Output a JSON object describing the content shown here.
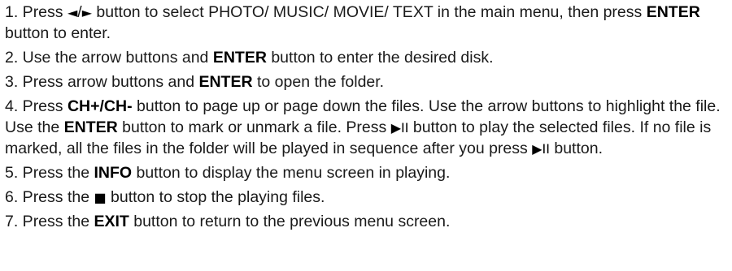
{
  "steps": [
    {
      "number": "1.",
      "parts": [
        {
          "text": " Press "
        },
        {
          "glyph": "◄",
          "icon": "left-arrow-icon"
        },
        {
          "text": "/"
        },
        {
          "glyph": "►",
          "icon": "right-arrow-icon"
        },
        {
          "text": " button to select PHOTO/ MUSIC/ MOVIE/ TEXT in the main menu, then press "
        },
        {
          "bold": "ENTER"
        },
        {
          "text": " button to enter."
        }
      ]
    },
    {
      "number": "2.",
      "parts": [
        {
          "text": " Use the arrow buttons and "
        },
        {
          "bold": "ENTER"
        },
        {
          "text": " button to enter the desired disk."
        }
      ]
    },
    {
      "number": "3.",
      "parts": [
        {
          "text": " Press arrow buttons and "
        },
        {
          "bold": "ENTER"
        },
        {
          "text": " to open the folder."
        }
      ]
    },
    {
      "number": "4.",
      "parts": [
        {
          "text": " Press "
        },
        {
          "bold": "CH+/CH-"
        },
        {
          "text": " button to page up or page down the files. Use the arrow buttons to highlight the file. Use the "
        },
        {
          "bold": "ENTER"
        },
        {
          "text": " button to mark or unmark a file. Press "
        },
        {
          "glyph": "▶II",
          "icon": "play-pause-icon"
        },
        {
          "text": " button to play the selected files. If no file is marked, all the files in the folder will be played in sequence after you press "
        },
        {
          "glyph": "▶II",
          "icon": "play-pause-icon"
        },
        {
          "text": " button."
        }
      ]
    },
    {
      "number": "5.",
      "parts": [
        {
          "text": " Press the "
        },
        {
          "bold": "INFO"
        },
        {
          "text": " button to display the menu screen in playing."
        }
      ]
    },
    {
      "number": "6.",
      "parts": [
        {
          "text": " Press the "
        },
        {
          "glyph": "■",
          "icon": "stop-icon"
        },
        {
          "text": " button to stop the playing files."
        }
      ]
    },
    {
      "number": "7.",
      "parts": [
        {
          "text": " Press the "
        },
        {
          "bold": "EXIT"
        },
        {
          "text": " button to return to the previous menu screen."
        }
      ]
    }
  ]
}
